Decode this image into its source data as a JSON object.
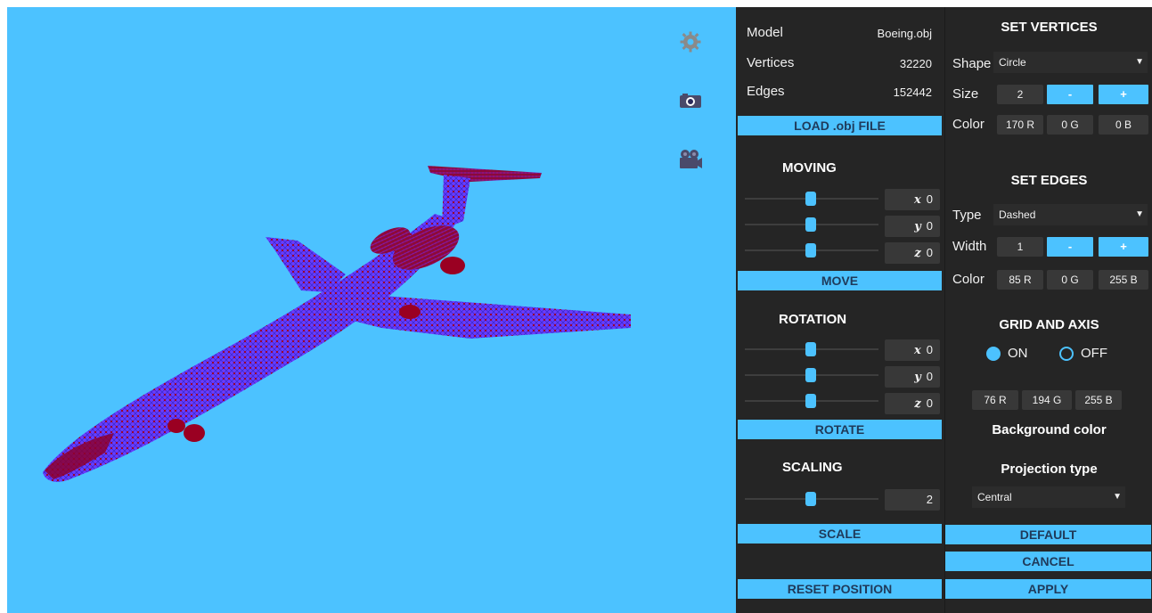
{
  "viewport": {
    "background": "#4cc2ff",
    "icons": [
      "gear-icon",
      "camera-icon",
      "video-camera-icon"
    ]
  },
  "model_info": {
    "model_label": "Model",
    "model_value": "Boeing.obj",
    "vertices_label": "Vertices",
    "vertices_value": "32220",
    "edges_label": "Edges",
    "edges_value": "152442"
  },
  "load_button": "LOAD .obj FILE",
  "moving": {
    "title": "MOVING",
    "x": "0",
    "y": "0",
    "z": "0",
    "button": "MOVE"
  },
  "rotation": {
    "title": "ROTATION",
    "x": "0",
    "y": "0",
    "z": "0",
    "button": "ROTATE"
  },
  "scaling": {
    "title": "SCALING",
    "value": "2",
    "button": "SCALE"
  },
  "reset_button": "RESET POSITION",
  "vertices": {
    "title": "SET VERTICES",
    "shape_label": "Shape",
    "shape_value": "Circle",
    "size_label": "Size",
    "size_value": "2",
    "color_label": "Color",
    "r": "170 R",
    "g": "0 G",
    "b": "0 B",
    "color": "#aa0000"
  },
  "edges": {
    "title": "SET EDGES",
    "type_label": "Type",
    "type_value": "Dashed",
    "width_label": "Width",
    "width_value": "1",
    "color_label": "Color",
    "r": "85 R",
    "g": "0 G",
    "b": "255 B",
    "color": "#5500ff"
  },
  "grid": {
    "title": "GRID AND AXIS",
    "on_label": "ON",
    "off_label": "OFF",
    "selected": "ON"
  },
  "background": {
    "r": "76 R",
    "g": "194 G",
    "b": "255 B",
    "label": "Background color"
  },
  "projection": {
    "title": "Projection type",
    "value": "Central"
  },
  "minus": "-",
  "plus": "+",
  "buttons": {
    "default": "DEFAULT",
    "cancel": "CANCEL",
    "apply": "APPLY"
  }
}
